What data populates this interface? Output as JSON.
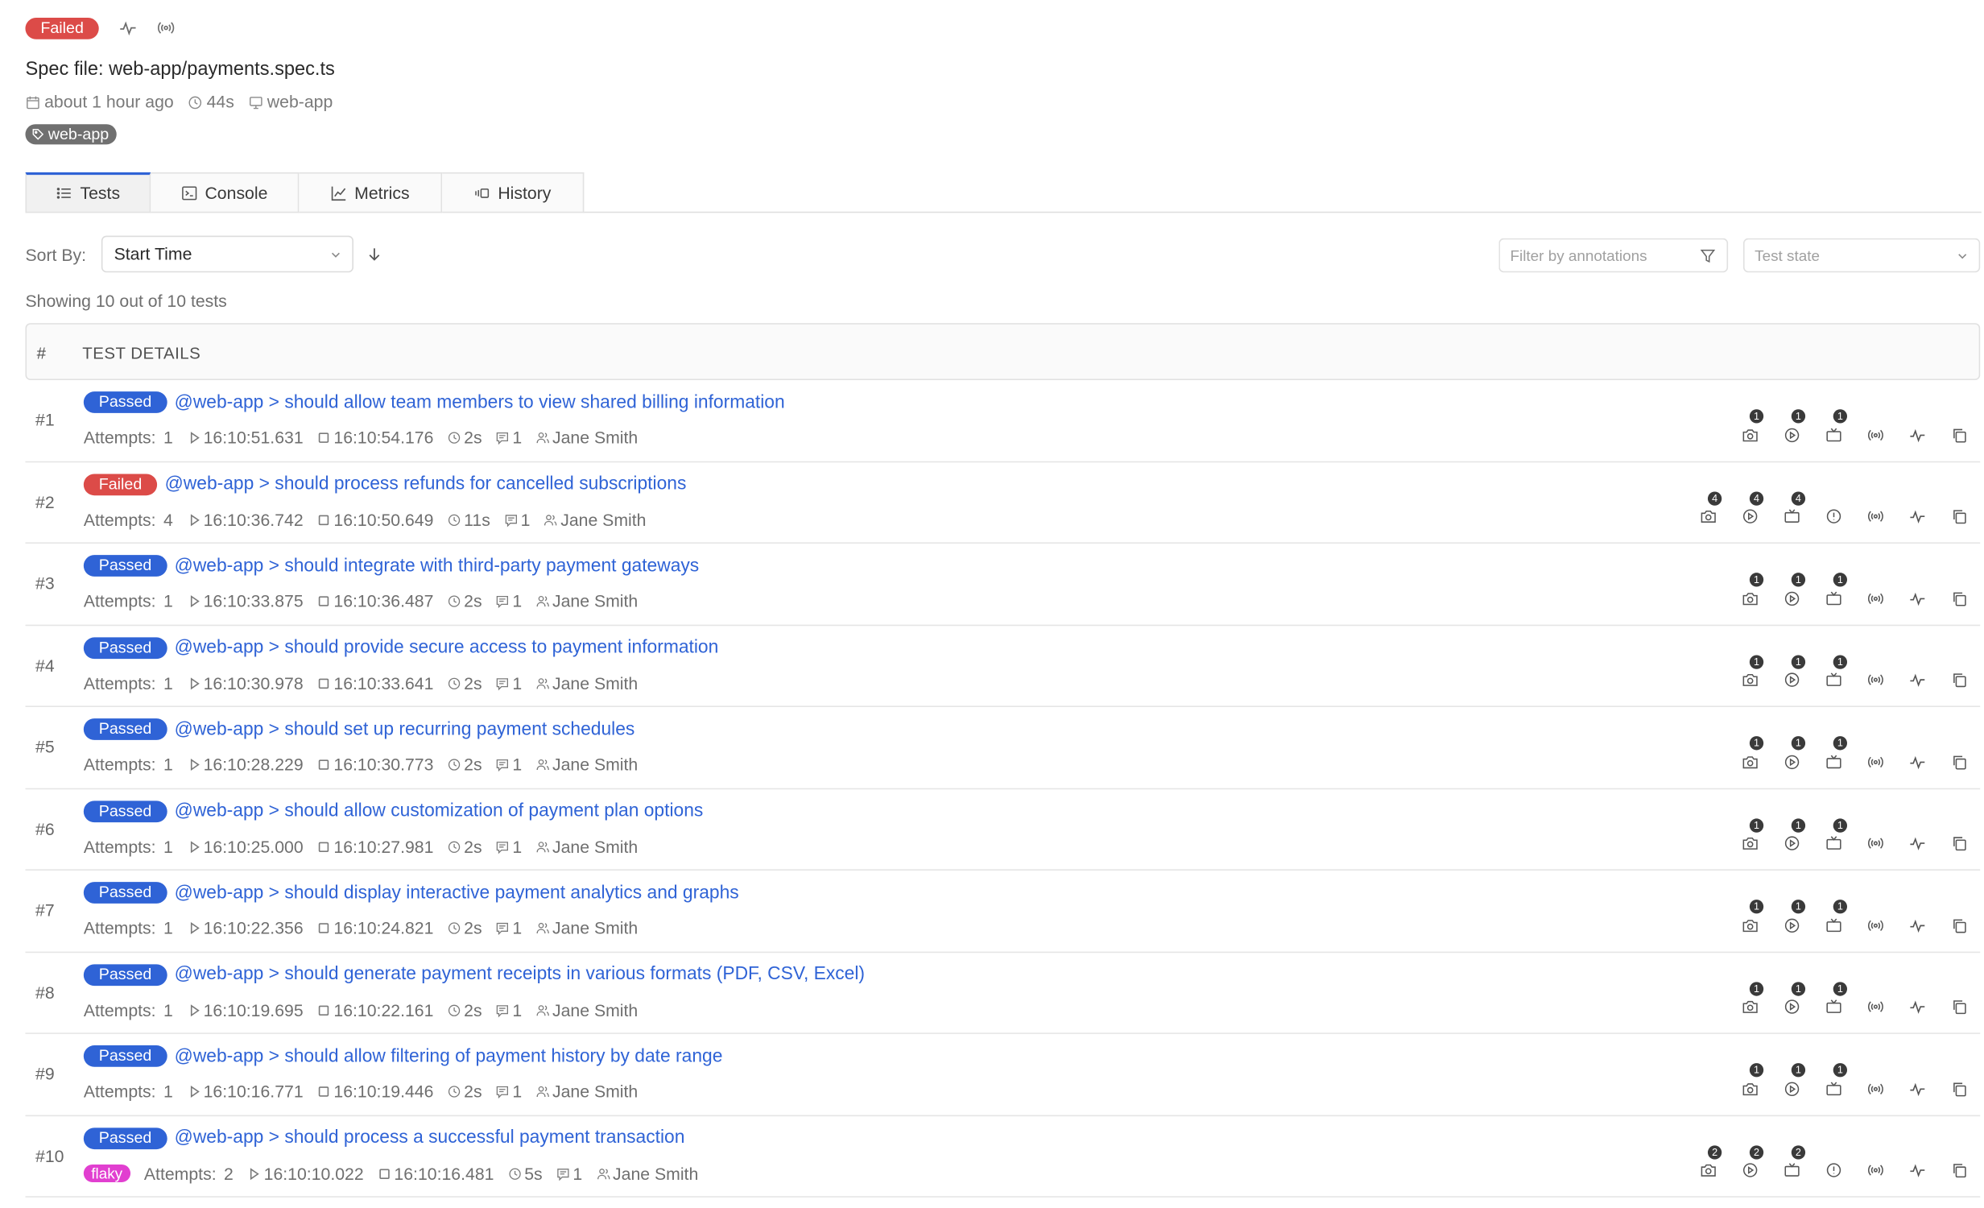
{
  "header": {
    "status": "Failed",
    "spec_title": "Spec file: web-app/payments.spec.ts",
    "started": "about 1 hour ago",
    "duration": "44s",
    "project": "web-app",
    "tag": "web-app"
  },
  "tabs": [
    {
      "label": "Tests",
      "icon": "list-icon"
    },
    {
      "label": "Console",
      "icon": "terminal-icon"
    },
    {
      "label": "Metrics",
      "icon": "chart-line-icon"
    },
    {
      "label": "History",
      "icon": "history-icon"
    }
  ],
  "toolbar": {
    "sort_label": "Sort By:",
    "sort_value": "Start Time",
    "filter_placeholder": "Filter by annotations",
    "state_placeholder": "Test state"
  },
  "summary": "Showing 10 out of 10 tests",
  "table": {
    "col_num": "#",
    "col_details": "TEST DETAILS",
    "attempts_label": "Attempts:"
  },
  "tests": [
    {
      "num": "#1",
      "status": "Passed",
      "title": "@web-app > should allow team members to view shared billing information",
      "attempts": "1",
      "start": "16:10:51.631",
      "end": "16:10:54.176",
      "duration": "2s",
      "annotations": "1",
      "owner": "Jane Smith",
      "flaky": "",
      "screenshots": "1",
      "videos": "1",
      "traces": "1",
      "has_error": false
    },
    {
      "num": "#2",
      "status": "Failed",
      "title": "@web-app > should process refunds for cancelled subscriptions",
      "attempts": "4",
      "start": "16:10:36.742",
      "end": "16:10:50.649",
      "duration": "11s",
      "annotations": "1",
      "owner": "Jane Smith",
      "flaky": "",
      "screenshots": "4",
      "videos": "4",
      "traces": "4",
      "has_error": true
    },
    {
      "num": "#3",
      "status": "Passed",
      "title": "@web-app > should integrate with third-party payment gateways",
      "attempts": "1",
      "start": "16:10:33.875",
      "end": "16:10:36.487",
      "duration": "2s",
      "annotations": "1",
      "owner": "Jane Smith",
      "flaky": "",
      "screenshots": "1",
      "videos": "1",
      "traces": "1",
      "has_error": false
    },
    {
      "num": "#4",
      "status": "Passed",
      "title": "@web-app > should provide secure access to payment information",
      "attempts": "1",
      "start": "16:10:30.978",
      "end": "16:10:33.641",
      "duration": "2s",
      "annotations": "1",
      "owner": "Jane Smith",
      "flaky": "",
      "screenshots": "1",
      "videos": "1",
      "traces": "1",
      "has_error": false
    },
    {
      "num": "#5",
      "status": "Passed",
      "title": "@web-app > should set up recurring payment schedules",
      "attempts": "1",
      "start": "16:10:28.229",
      "end": "16:10:30.773",
      "duration": "2s",
      "annotations": "1",
      "owner": "Jane Smith",
      "flaky": "",
      "screenshots": "1",
      "videos": "1",
      "traces": "1",
      "has_error": false
    },
    {
      "num": "#6",
      "status": "Passed",
      "title": "@web-app > should allow customization of payment plan options",
      "attempts": "1",
      "start": "16:10:25.000",
      "end": "16:10:27.981",
      "duration": "2s",
      "annotations": "1",
      "owner": "Jane Smith",
      "flaky": "",
      "screenshots": "1",
      "videos": "1",
      "traces": "1",
      "has_error": false
    },
    {
      "num": "#7",
      "status": "Passed",
      "title": "@web-app > should display interactive payment analytics and graphs",
      "attempts": "1",
      "start": "16:10:22.356",
      "end": "16:10:24.821",
      "duration": "2s",
      "annotations": "1",
      "owner": "Jane Smith",
      "flaky": "",
      "screenshots": "1",
      "videos": "1",
      "traces": "1",
      "has_error": false
    },
    {
      "num": "#8",
      "status": "Passed",
      "title": "@web-app > should generate payment receipts in various formats (PDF, CSV, Excel)",
      "attempts": "1",
      "start": "16:10:19.695",
      "end": "16:10:22.161",
      "duration": "2s",
      "annotations": "1",
      "owner": "Jane Smith",
      "flaky": "",
      "screenshots": "1",
      "videos": "1",
      "traces": "1",
      "has_error": false
    },
    {
      "num": "#9",
      "status": "Passed",
      "title": "@web-app > should allow filtering of payment history by date range",
      "attempts": "1",
      "start": "16:10:16.771",
      "end": "16:10:19.446",
      "duration": "2s",
      "annotations": "1",
      "owner": "Jane Smith",
      "flaky": "",
      "screenshots": "1",
      "videos": "1",
      "traces": "1",
      "has_error": false
    },
    {
      "num": "#10",
      "status": "Passed",
      "title": "@web-app > should process a successful payment transaction",
      "attempts": "2",
      "start": "16:10:10.022",
      "end": "16:10:16.481",
      "duration": "5s",
      "annotations": "1",
      "owner": "Jane Smith",
      "flaky": "flaky",
      "screenshots": "2",
      "videos": "2",
      "traces": "2",
      "has_error": true
    }
  ],
  "colors": {
    "passed": "#2f63d6",
    "failed": "#dc4b48",
    "flaky": "#e13fd0",
    "link": "#2f63d6"
  }
}
